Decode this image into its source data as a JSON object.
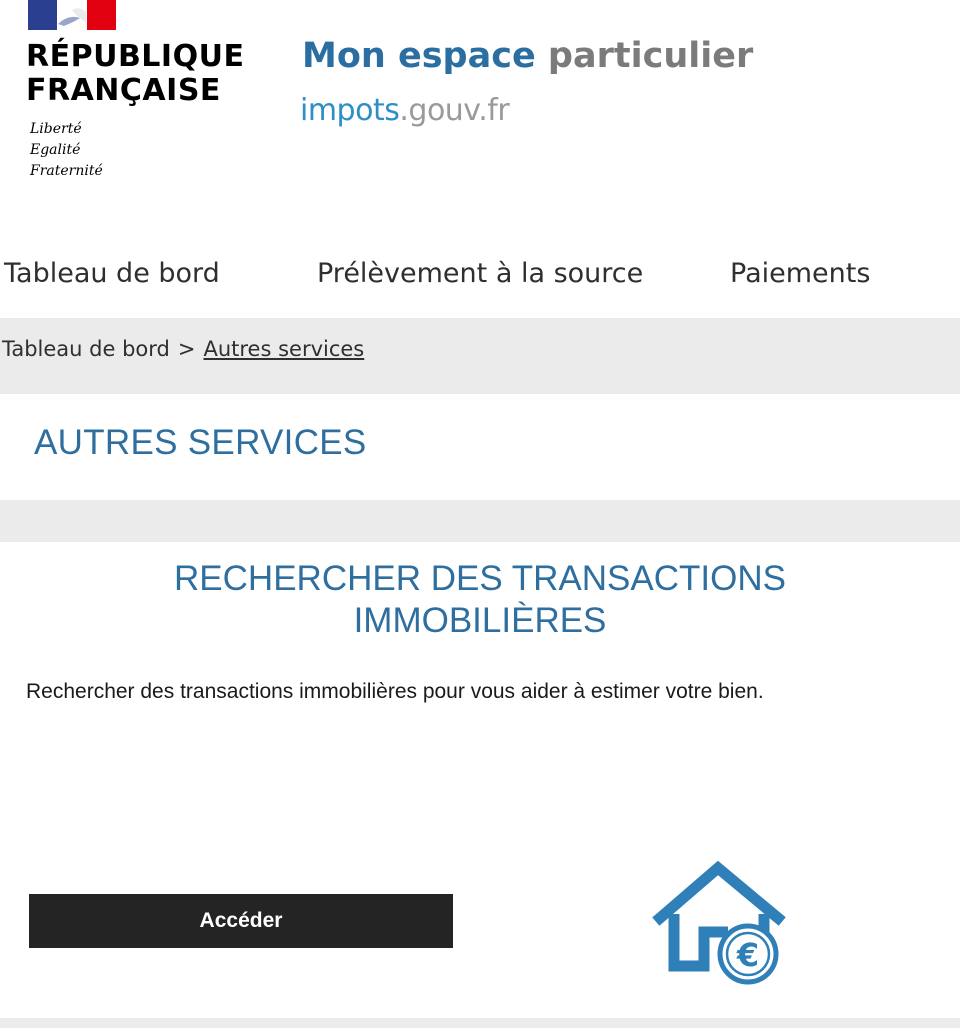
{
  "header": {
    "rf_line1": "RÉPUBLIQUE",
    "rf_line2": "FRANÇAISE",
    "motto": [
      "Liberté",
      "Egalité",
      "Fraternité"
    ],
    "app_title_strong": "Mon espace",
    "app_title_light": "particulier",
    "site_logo_a": "impots",
    "site_logo_b": ".gouv.fr"
  },
  "nav": {
    "items": [
      {
        "label": "Tableau de bord"
      },
      {
        "label": "Prélèvement à la source"
      },
      {
        "label": "Paiements"
      }
    ]
  },
  "breadcrumb": {
    "root": "Tableau de bord",
    "separator": ">",
    "current": "Autres services"
  },
  "page": {
    "title": "AUTRES SERVICES"
  },
  "card": {
    "title_line1": "RECHERCHER DES TRANSACTIONS",
    "title_line2": "IMMOBILIÈRES",
    "description": "Rechercher des transactions immobilières pour vous aider à estimer votre bien.",
    "button_label": "Accéder",
    "icon": "house-euro-icon"
  },
  "colors": {
    "primary_blue": "#2f6f9f",
    "logo_blue": "#2e8fc4",
    "grey_text": "#7b7b7b",
    "button_dark": "#242424",
    "page_background": "#ebebeb"
  }
}
